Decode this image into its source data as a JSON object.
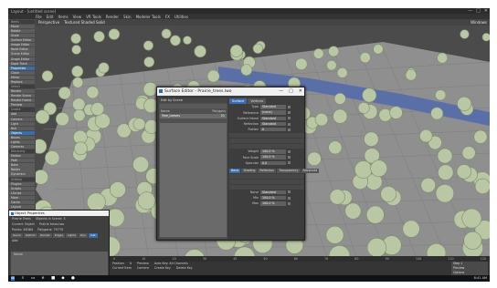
{
  "app": {
    "title": "Layout - [untitled scene]",
    "window_controls": [
      "—",
      "□",
      "✕"
    ]
  },
  "menubar": [
    "File",
    "Edit",
    "Items",
    "View",
    "VR Tools",
    "Render",
    "Skin",
    "Modeler Tools",
    "FX",
    "Utilities"
  ],
  "viewport": {
    "mode": "Perspective",
    "shading": "Textured Shaded Solid",
    "right_label": "Windows"
  },
  "left_toolbar": {
    "items": [
      {
        "label": "Items",
        "state": "hdr"
      },
      {
        "label": "Move",
        "state": ""
      },
      {
        "label": "Rotate",
        "state": ""
      },
      {
        "label": "Scale",
        "state": ""
      },
      {
        "label": "Surface Editor",
        "state": ""
      },
      {
        "label": "Image Editor",
        "state": ""
      },
      {
        "label": "Node Editor",
        "state": ""
      },
      {
        "label": "Scene Editor",
        "state": ""
      },
      {
        "label": "Graph Editor",
        "state": ""
      },
      {
        "label": "Dope Track",
        "state": ""
      },
      {
        "label": "Properties",
        "state": "hl"
      },
      {
        "label": "Clone",
        "state": ""
      },
      {
        "label": "Mirror",
        "state": ""
      },
      {
        "label": "Replace",
        "state": ""
      },
      {
        "label": "Select",
        "state": "hdr"
      },
      {
        "label": "Render",
        "state": ""
      },
      {
        "label": "Render Scene",
        "state": ""
      },
      {
        "label": "Render Frame",
        "state": ""
      },
      {
        "label": "Preview",
        "state": ""
      },
      {
        "label": "Create",
        "state": "hdr"
      },
      {
        "label": "Add",
        "state": ""
      },
      {
        "label": "Camera",
        "state": ""
      },
      {
        "label": "Light",
        "state": ""
      },
      {
        "label": "Null",
        "state": ""
      },
      {
        "label": "Objects",
        "state": "hl"
      },
      {
        "label": "Bones",
        "state": ""
      },
      {
        "label": "Lights",
        "state": ""
      },
      {
        "label": "Cameras",
        "state": ""
      },
      {
        "label": "Hierarchy",
        "state": "hdr"
      },
      {
        "label": "Motion",
        "state": ""
      },
      {
        "label": "Path",
        "state": ""
      },
      {
        "label": "Bake",
        "state": ""
      },
      {
        "label": "Nodes",
        "state": ""
      },
      {
        "label": "Dynamics",
        "state": ""
      },
      {
        "label": "Utilities",
        "state": "hdr"
      },
      {
        "label": "Plugins",
        "state": ""
      },
      {
        "label": "Scripts",
        "state": ""
      },
      {
        "label": "LScript",
        "state": ""
      },
      {
        "label": "More",
        "state": ""
      },
      {
        "label": "Cache",
        "state": ""
      },
      {
        "label": "Layout",
        "state": ""
      },
      {
        "label": "Presets",
        "state": ""
      },
      {
        "label": "Options",
        "state": ""
      }
    ]
  },
  "surface_editor": {
    "title": "Surface Editor - Prairie_trees.lwo",
    "controls": [
      "—",
      "□",
      "✕"
    ],
    "edit_by": "Edit by  Scene",
    "list_header": {
      "name": "Name",
      "count": "Polygons"
    },
    "list_items": [
      {
        "name": "Tree_Leaves",
        "count": "21"
      }
    ],
    "tabs": [
      "Surface",
      "Vertices"
    ],
    "properties_top": [
      {
        "label": "Type",
        "value": "Standard"
      },
      {
        "label": "Reference",
        "value": "(none)"
      },
      {
        "label": "Surface Name",
        "value": "Standard"
      },
      {
        "label": "Reflection",
        "value": "Standard"
      },
      {
        "label": "Flatten",
        "value": "0"
      }
    ],
    "properties_mid": [
      {
        "label": "Weight",
        "value": "100.0 %"
      },
      {
        "label": "Face Scale",
        "value": "100.0 %"
      },
      {
        "label": "Specular",
        "value": "0.0"
      }
    ],
    "subtabs": [
      "Basic",
      "Shading",
      "Reflection",
      "Transparency",
      "Advanced"
    ],
    "properties_bottom": [
      {
        "label": "Noise",
        "value": "Standard"
      },
      {
        "label": "Min",
        "value": "100.0 %"
      },
      {
        "label": "Max",
        "value": "100.0 %"
      }
    ]
  },
  "object_properties": {
    "title": "Object Properties",
    "object": "Prairie Trees",
    "objects_in_scene": "Objects in Scene: 3",
    "current_object": "Current Object",
    "current_value": "Prairie trees.lwo",
    "points": "Points: 48384",
    "polygons": "Polygons: 79770",
    "tabs": [
      "Geom",
      "Deform",
      "Render",
      "Edges",
      "Lights",
      "Dyn",
      "Inst"
    ],
    "tab_selected": "Inst",
    "list_add": "Add",
    "list_header": "Name"
  },
  "timeline": {
    "ticks": [
      "0",
      "10",
      "20",
      "30",
      "40",
      "50",
      "60",
      "70",
      "80",
      "90",
      "100",
      "110",
      "120"
    ],
    "row1": [
      "Position",
      "0",
      "Preview",
      "Auto Key: All Channels"
    ],
    "row2": [
      "Current Item",
      "Camera",
      "Create Key",
      "Delete Key"
    ],
    "right_buttons": [
      "Step 1",
      "Preview",
      "Options"
    ]
  },
  "taskbar": {
    "icons": [
      "⊞",
      "⌕",
      "▭",
      "e",
      "■",
      "◆",
      "●"
    ],
    "clock": "8:41 AM"
  },
  "colors": {
    "viewport_bg": "#4b4b4b",
    "ground": "#8f8f8f",
    "river": "#5a6fa8",
    "foliage": "#b9c7a4",
    "accent": "#3b6ea8"
  }
}
